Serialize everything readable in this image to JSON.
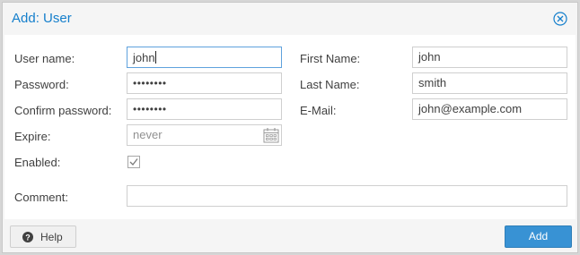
{
  "dialog": {
    "title": "Add: User"
  },
  "form": {
    "username": {
      "label": "User name:",
      "value": "john"
    },
    "password": {
      "label": "Password:",
      "value": "••••••••"
    },
    "confirm_password": {
      "label": "Confirm password:",
      "value": "••••••••"
    },
    "expire": {
      "label": "Expire:",
      "placeholder": "never"
    },
    "enabled": {
      "label": "Enabled:",
      "checked": true
    },
    "first_name": {
      "label": "First Name:",
      "value": "john"
    },
    "last_name": {
      "label": "Last Name:",
      "value": "smith"
    },
    "email": {
      "label": "E-Mail:",
      "value": "john@example.com"
    },
    "comment": {
      "label": "Comment:",
      "value": ""
    }
  },
  "toolbar": {
    "help_label": "Help",
    "add_label": "Add"
  },
  "colors": {
    "title": "#157fcc",
    "primary_button": "#3892d4",
    "focus_border": "#5fa2dd"
  },
  "icons": {
    "close": "close-circle-icon",
    "help": "question-circle-icon",
    "calendar": "calendar-icon",
    "check": "checkmark-icon"
  }
}
